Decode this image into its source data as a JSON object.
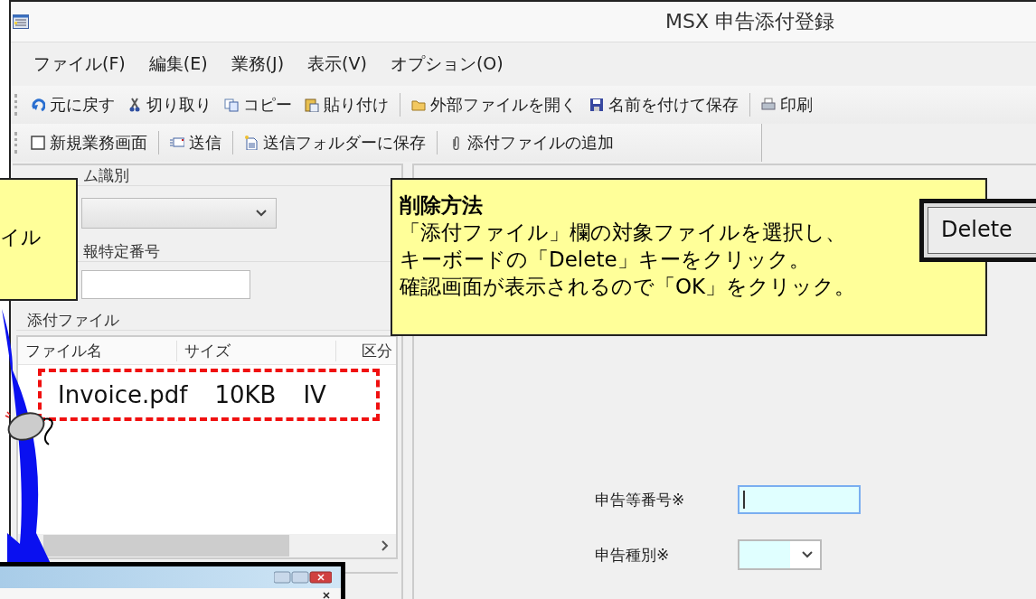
{
  "window": {
    "title": "MSX 申告添付登録"
  },
  "menu": [
    {
      "label": "ファイル(F)"
    },
    {
      "label": "編集(E)"
    },
    {
      "label": "業務(J)"
    },
    {
      "label": "表示(V)"
    },
    {
      "label": "オプション(O)"
    }
  ],
  "toolbar_1": [
    {
      "label": "元に戻す",
      "kind": "undo",
      "separator_before": false
    },
    {
      "label": "切り取り",
      "kind": "cut",
      "separator_before": false
    },
    {
      "label": "コピー",
      "kind": "copy",
      "separator_before": false
    },
    {
      "label": "貼り付け",
      "kind": "paste",
      "separator_before": false
    },
    {
      "label": "外部ファイルを開く",
      "kind": "open",
      "separator_before": true
    },
    {
      "label": "名前を付けて保存",
      "kind": "save",
      "separator_before": false
    },
    {
      "label": "印刷",
      "kind": "print",
      "separator_before": true
    }
  ],
  "toolbar_2": [
    {
      "label": "新規業務画面",
      "kind": "new",
      "separator_before": false
    },
    {
      "label": "送信",
      "kind": "send",
      "separator_before": true
    },
    {
      "label": "送信フォルダーに保存",
      "kind": "folder-save",
      "separator_before": true
    },
    {
      "label": "添付ファイルの追加",
      "kind": "attach",
      "separator_before": true
    }
  ],
  "left_panel": {
    "system_group": {
      "label": "ム識別"
    },
    "info_group": {
      "label": "報特定番号"
    },
    "attachments": {
      "label": "添付ファイル",
      "columns": [
        "ファイル名",
        "サイズ",
        "区分"
      ],
      "rows": [
        {
          "cells": [
            "Invoice.pdf",
            "10KB",
            "IV"
          ],
          "highlighted": true
        }
      ]
    }
  },
  "form": {
    "fields": [
      {
        "label": "申告等番号※",
        "kind": "text",
        "focused": true
      },
      {
        "label": "申告種別※",
        "kind": "select",
        "focused": false
      }
    ]
  },
  "callouts": [
    {
      "lines": [
        "イル"
      ]
    },
    {
      "title": "削除方法",
      "lines": [
        "「添付ファイル」欄の対象ファイルを選択し、",
        "キーボードの「Delete」キーをクリック。",
        "確認画面が表示されるので「OK」をクリック。"
      ]
    }
  ],
  "key": {
    "label": "Delete"
  }
}
